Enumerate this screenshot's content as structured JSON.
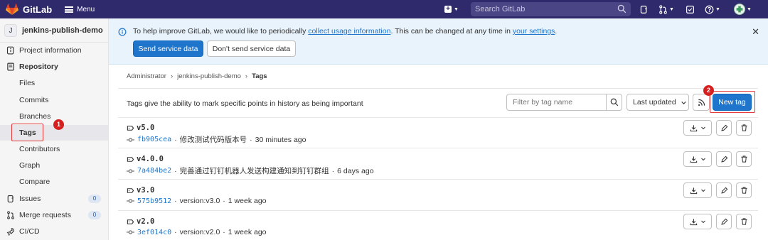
{
  "topbar": {
    "brand": "GitLab",
    "menu_label": "Menu",
    "search_placeholder": "Search GitLab",
    "brand_color": "#2f2a6b",
    "icons": [
      "create-new-icon",
      "search-icon",
      "issues-icon",
      "merge-requests-icon",
      "todos-icon",
      "help-icon",
      "user-avatar"
    ]
  },
  "sidebar": {
    "avatar_letter": "J",
    "project_name": "jenkins-publish-demo",
    "items": [
      {
        "label": "Project information",
        "icon": "info-icon"
      },
      {
        "label": "Repository",
        "icon": "repository-icon"
      },
      {
        "label": "Files"
      },
      {
        "label": "Commits"
      },
      {
        "label": "Branches"
      },
      {
        "label": "Tags",
        "active": true
      },
      {
        "label": "Contributors"
      },
      {
        "label": "Graph"
      },
      {
        "label": "Compare"
      },
      {
        "label": "Issues",
        "icon": "issues-icon",
        "count": "0"
      },
      {
        "label": "Merge requests",
        "icon": "merge-request-icon",
        "count": "0"
      },
      {
        "label": "CI/CD",
        "icon": "rocket-icon"
      }
    ]
  },
  "banner": {
    "text_prefix": "To help improve GitLab, we would like to periodically ",
    "link1": "collect usage information",
    "text_middle": ". This can be changed at any time in ",
    "link2": "your settings",
    "text_suffix": ".",
    "send_button": "Send service data",
    "dont_send_button": "Don't send service data"
  },
  "breadcrumb": [
    "Administrator",
    "jenkins-publish-demo",
    "Tags"
  ],
  "main": {
    "description": "Tags give the ability to mark specific points in history as being important",
    "filter_placeholder": "Filter by tag name",
    "sort_label": "Last updated",
    "new_tag_button": "New tag"
  },
  "tags": [
    {
      "name": "v5.0",
      "sha": "fb905cea",
      "message": "修改测试代码版本号",
      "time": "30 minutes ago"
    },
    {
      "name": "v4.0.0",
      "sha": "7a484be2",
      "message": "完善通过钉钉机器人发送构建通知到钉钉群组",
      "time": "6 days ago"
    },
    {
      "name": "v3.0",
      "sha": "575b9512",
      "message": "version:v3.0",
      "time": "1 week ago"
    },
    {
      "name": "v2.0",
      "sha": "3ef014c0",
      "message": "version:v2.0",
      "time": "1 week ago"
    }
  ],
  "annotations": {
    "marker1": "1",
    "marker2": "2",
    "highlight_color": "#d62020"
  }
}
